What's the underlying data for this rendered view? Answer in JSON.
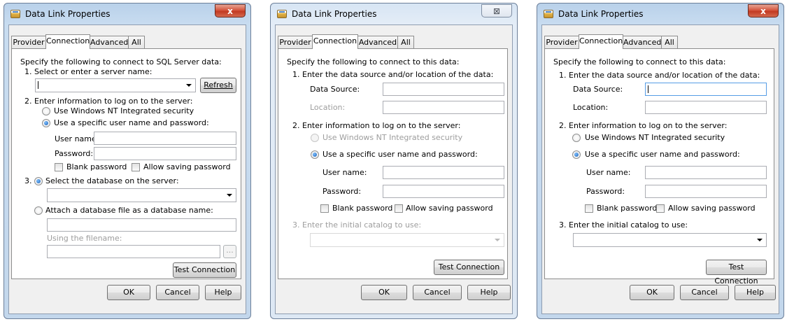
{
  "dialogs": [
    {
      "title": "Data Link Properties",
      "close": "x",
      "tabs": [
        "Provider",
        "Connection",
        "Advanced",
        "All"
      ],
      "intro": "Specify the following to connect to SQL Server data:",
      "step1": "1. Select or enter a server name:",
      "server_value": "",
      "refresh": "Refresh",
      "step2": "2. Enter information to log on to the server:",
      "opt_windows": "Use Windows NT Integrated security",
      "opt_specific": "Use a specific user name and password:",
      "user_label": "User name:",
      "password_label": "Password:",
      "blank_password": "Blank password",
      "allow_saving": "Allow saving password",
      "step3_num": "3.",
      "opt_select_db": "Select the database on the server:",
      "opt_attach": "Attach a database file as a database name:",
      "using_filename": "Using the filename:",
      "browse": "...",
      "test": "Test Connection",
      "ok": "OK",
      "cancel": "Cancel",
      "help": "Help"
    },
    {
      "title": "Data Link Properties",
      "close": "⊠",
      "tabs": [
        "Provider",
        "Connection",
        "Advanced",
        "All"
      ],
      "intro": "Specify the following to connect to this data:",
      "step1": "1. Enter the data source and/or location of the data:",
      "data_source_label": "Data Source:",
      "location_label": "Location:",
      "step2": "2. Enter information to log on to the server:",
      "opt_windows": "Use Windows NT Integrated security",
      "opt_specific": "Use a specific user name and password:",
      "user_label": "User name:",
      "password_label": "Password:",
      "blank_password": "Blank password",
      "allow_saving": "Allow saving password",
      "step3": "3. Enter the initial catalog to use:",
      "test": "Test Connection",
      "ok": "OK",
      "cancel": "Cancel",
      "help": "Help"
    },
    {
      "title": "Data Link Properties",
      "close": "x",
      "tabs": [
        "Provider",
        "Connection",
        "Advanced",
        "All"
      ],
      "intro": "Specify the following to connect to this data:",
      "step1": "1. Enter the data source and/or location of the data:",
      "data_source_label": "Data Source:",
      "location_label": "Location:",
      "step2": "2. Enter information to log on to the server:",
      "opt_windows": "Use Windows NT Integrated security",
      "opt_specific": "Use a specific user name and password:",
      "user_label": "User name:",
      "password_label": "Password:",
      "blank_password": "Blank password",
      "allow_saving": "Allow saving password",
      "step3": "3. Enter the initial catalog to use:",
      "test": "Test Connection",
      "ok": "OK",
      "cancel": "Cancel",
      "help": "Help"
    }
  ]
}
